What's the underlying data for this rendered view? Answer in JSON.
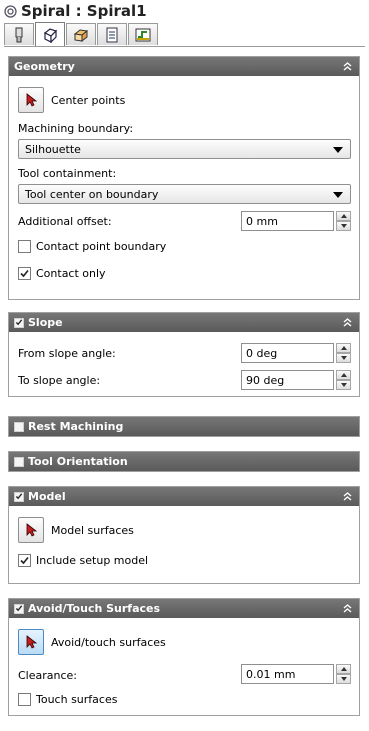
{
  "window": {
    "title": "Spiral : Spiral1"
  },
  "tabs": [
    {
      "name": "tool-tab",
      "icon": "tool-icon"
    },
    {
      "name": "geometry-tab",
      "icon": "geometry-cube-icon",
      "active": true
    },
    {
      "name": "heights-tab",
      "icon": "heights-icon"
    },
    {
      "name": "passes-tab",
      "icon": "passes-icon"
    },
    {
      "name": "linking-tab",
      "icon": "linking-icon"
    }
  ],
  "geometry": {
    "header": "Geometry",
    "center_points_label": "Center points",
    "machining_boundary_label": "Machining boundary:",
    "machining_boundary_value": "Silhouette",
    "tool_containment_label": "Tool containment:",
    "tool_containment_value": "Tool center on boundary",
    "additional_offset_label": "Additional offset:",
    "additional_offset_value": "0 mm",
    "contact_point_boundary_label": "Contact point boundary",
    "contact_point_boundary_checked": false,
    "contact_only_label": "Contact only",
    "contact_only_checked": true
  },
  "slope": {
    "header": "Slope",
    "enabled": true,
    "from_label": "From slope angle:",
    "from_value": "0 deg",
    "to_label": "To slope angle:",
    "to_value": "90 deg"
  },
  "rest_machining": {
    "header": "Rest Machining",
    "enabled": false
  },
  "tool_orientation": {
    "header": "Tool Orientation",
    "enabled": false
  },
  "model": {
    "header": "Model",
    "enabled": true,
    "surfaces_label": "Model surfaces",
    "include_setup_label": "Include setup model",
    "include_setup_checked": true
  },
  "avoid": {
    "header": "Avoid/Touch Surfaces",
    "enabled": true,
    "surfaces_label": "Avoid/touch surfaces",
    "clearance_label": "Clearance:",
    "clearance_value": "0.01 mm",
    "touch_label": "Touch surfaces",
    "touch_checked": false
  }
}
